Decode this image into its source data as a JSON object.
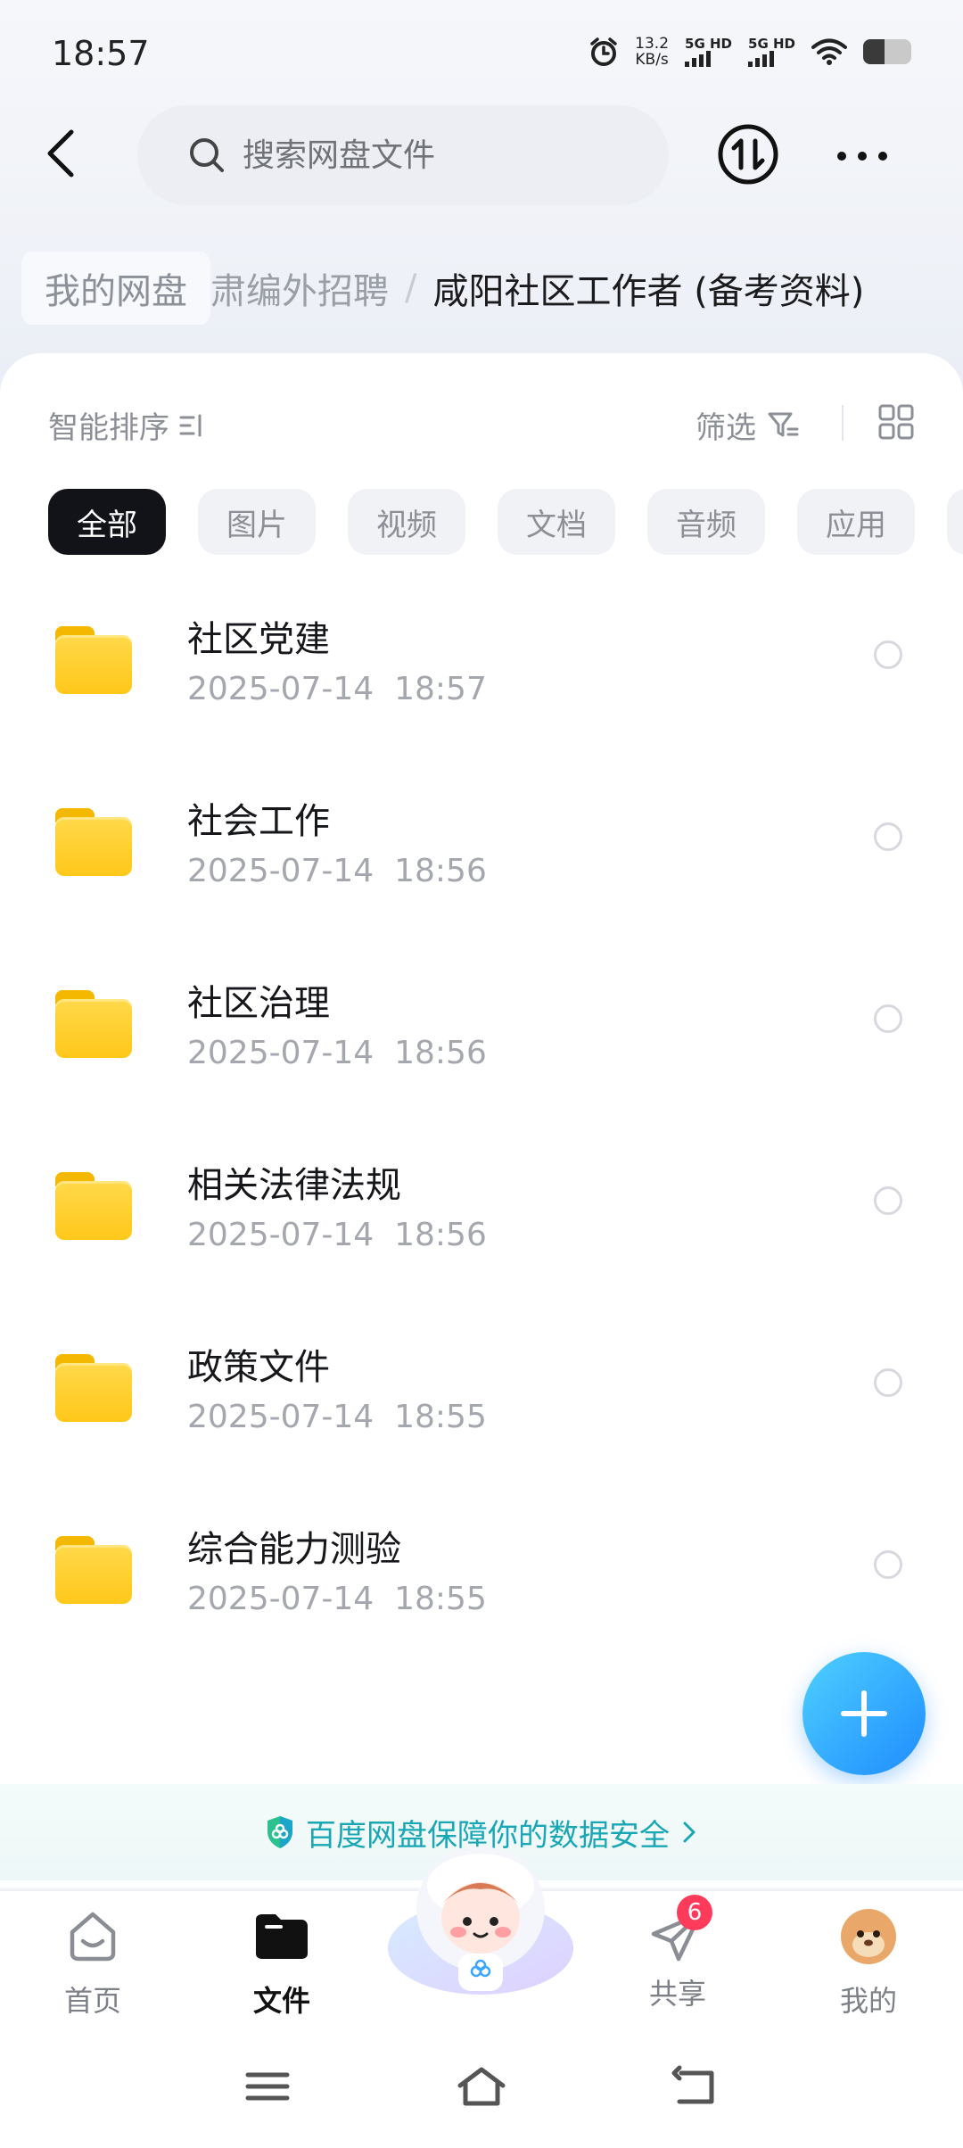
{
  "status_bar": {
    "time": "18:57",
    "net_speed_value": "13.2",
    "net_speed_unit": "KB/s",
    "sim1_label": "5G HD",
    "sim2_label": "5G HD",
    "battery_level": 0.45
  },
  "header": {
    "search_placeholder": "搜索网盘文件"
  },
  "breadcrumb": {
    "root": "我的网盘",
    "middle": "肃编外招聘",
    "separator": "/",
    "current": "咸阳社区工作者 (备考资料)"
  },
  "toolbar": {
    "sort_label": "智能排序",
    "filter_label": "筛选"
  },
  "chips": [
    "全部",
    "图片",
    "视频",
    "文档",
    "音频",
    "应用"
  ],
  "files": [
    {
      "name": "社区党建",
      "date": "2025-07-14",
      "time": "18:57"
    },
    {
      "name": "社会工作",
      "date": "2025-07-14",
      "time": "18:56"
    },
    {
      "name": "社区治理",
      "date": "2025-07-14",
      "time": "18:56"
    },
    {
      "name": "相关法律法规",
      "date": "2025-07-14",
      "time": "18:56"
    },
    {
      "name": "政策文件",
      "date": "2025-07-14",
      "time": "18:55"
    },
    {
      "name": "综合能力测验",
      "date": "2025-07-14",
      "time": "18:55"
    }
  ],
  "security_banner": {
    "text": "百度网盘保障你的数据安全",
    "color": "#19a7b6"
  },
  "tabbar": {
    "home": "首页",
    "files": "文件",
    "share": "共享",
    "share_badge": "6",
    "mine": "我的"
  },
  "colors": {
    "accent": "#1e8cff",
    "chip_active_bg": "#111318",
    "folder": "#ffc81a",
    "badge": "#ff3b5c"
  }
}
